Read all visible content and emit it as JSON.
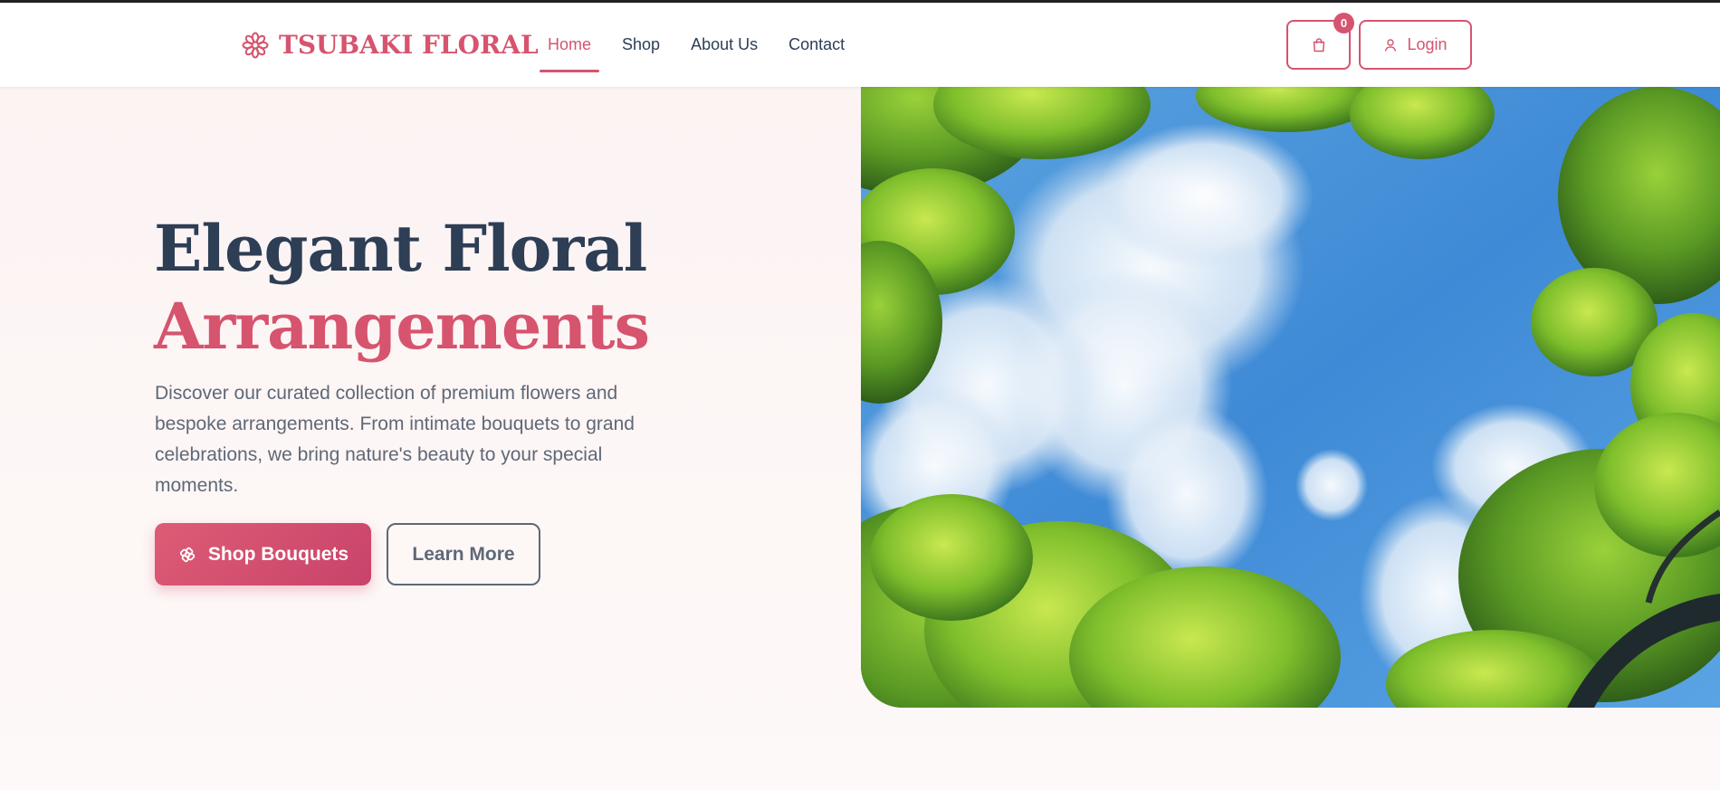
{
  "brand": {
    "name": "TSUBAKI FLORAL",
    "accent_color": "#d6546e",
    "logo_icon": "flower-icon"
  },
  "nav": {
    "items": [
      {
        "label": "Home",
        "active": true
      },
      {
        "label": "Shop",
        "active": false
      },
      {
        "label": "About Us",
        "active": false
      },
      {
        "label": "Contact",
        "active": false
      }
    ]
  },
  "header_actions": {
    "cart_icon": "shopping-bag-icon",
    "cart_count": "0",
    "login_icon": "user-icon",
    "login_label": "Login"
  },
  "hero": {
    "title_line1": "Elegant Floral",
    "title_line2": "Arrangements",
    "description": "Discover our curated collection of premium flowers and bespoke arrangements. From intimate bouquets to grand celebrations, we bring nature's beauty to your special moments.",
    "primary_button": "Shop Bouquets",
    "primary_button_icon": "flower-icon",
    "secondary_button": "Learn More",
    "image": "sky-through-tree-canopy"
  },
  "colors": {
    "heading": "#2d3e55",
    "body_text": "#5f6877",
    "hero_background": "#fcf3f3"
  }
}
